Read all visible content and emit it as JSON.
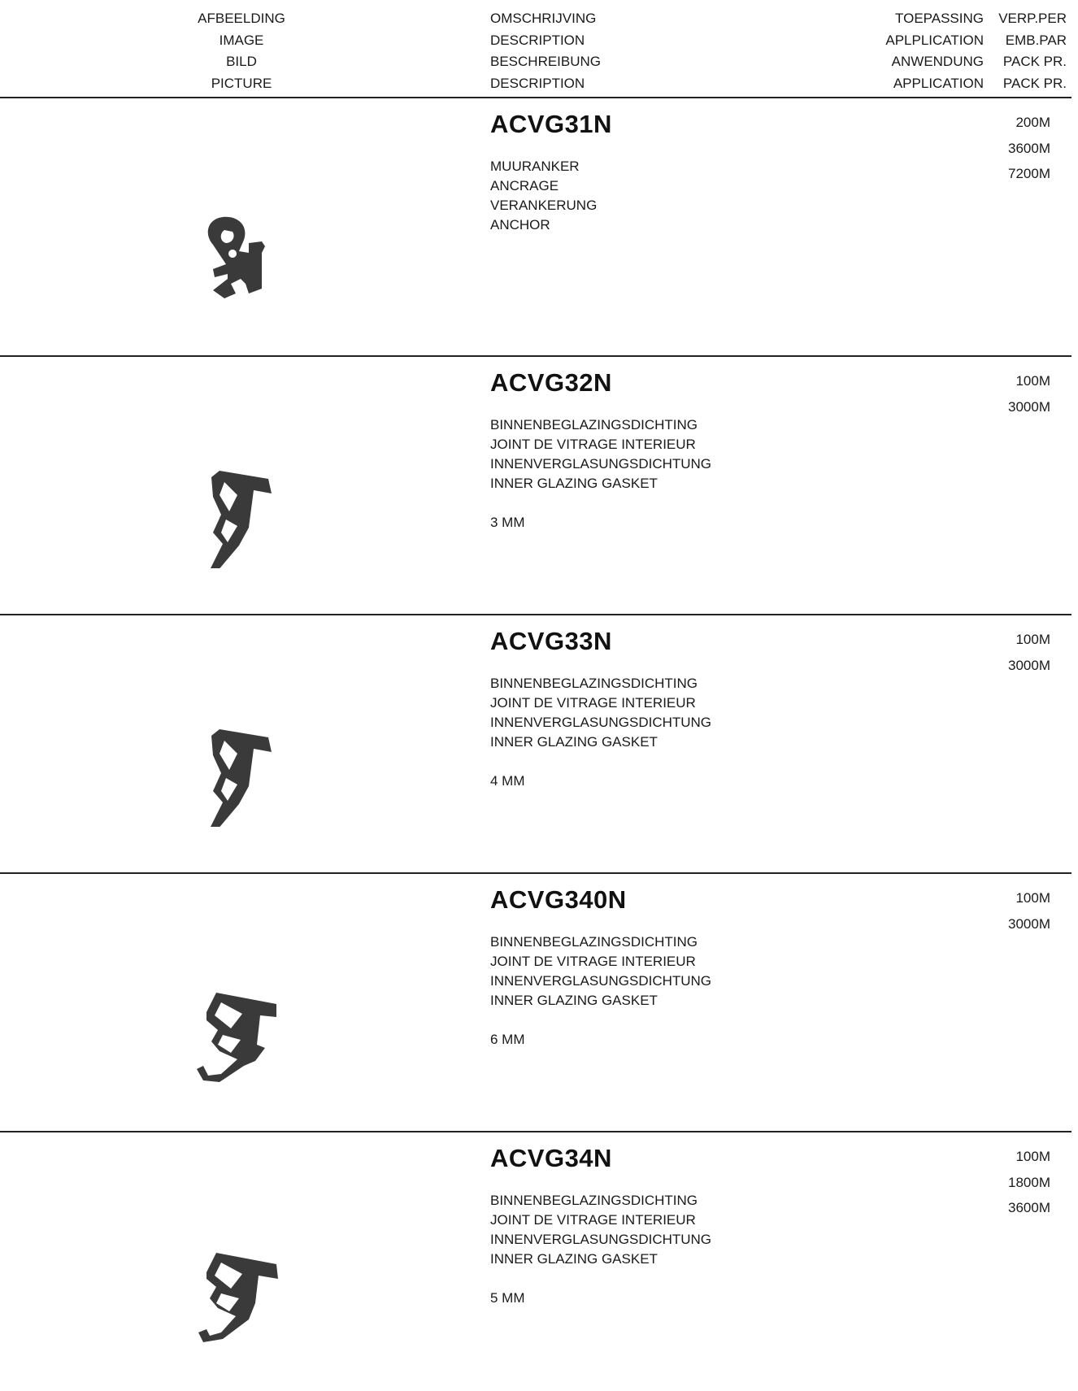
{
  "header": {
    "image": [
      "AFBEELDING",
      "IMAGE",
      "BILD",
      "PICTURE"
    ],
    "description": [
      "OMSCHRIJVING",
      "DESCRIPTION",
      "BESCHREIBUNG",
      "DESCRIPTION"
    ],
    "application": [
      "TOEPASSING",
      "APLPLICATION",
      "ANWENDUNG",
      "APPLICATION"
    ],
    "packaging": [
      "VERP.PER",
      "EMB.PAR",
      "PACK PR.",
      "PACK PR."
    ]
  },
  "products": [
    {
      "code": "ACVG31N",
      "description": [
        "MUURANKER",
        "ANCRAGE",
        "VERANKERUNG",
        "ANCHOR"
      ],
      "size": "",
      "packs": [
        "200M",
        "3600M",
        "7200M"
      ],
      "icon": "anchor-profile-icon"
    },
    {
      "code": "ACVG32N",
      "description": [
        "BINNENBEGLAZINGSDICHTING",
        "JOINT DE VITRAGE INTERIEUR",
        "INNENVERGLASUNGSDICHTUNG",
        "INNER GLAZING GASKET"
      ],
      "size": "3 MM",
      "packs": [
        "100M",
        "3000M"
      ],
      "icon": "glazing-gasket-profile-icon"
    },
    {
      "code": "ACVG33N",
      "description": [
        "BINNENBEGLAZINGSDICHTING",
        "JOINT DE VITRAGE INTERIEUR",
        "INNENVERGLASUNGSDICHTUNG",
        "INNER GLAZING GASKET"
      ],
      "size": "4 MM",
      "packs": [
        "100M",
        "3000M"
      ],
      "icon": "glazing-gasket-profile-icon"
    },
    {
      "code": "ACVG340N",
      "description": [
        "BINNENBEGLAZINGSDICHTING",
        "JOINT DE VITRAGE INTERIEUR",
        "INNENVERGLASUNGSDICHTUNG",
        "INNER GLAZING GASKET"
      ],
      "size": "6 MM",
      "packs": [
        "100M",
        "3000M"
      ],
      "icon": "glazing-gasket-profile-icon"
    },
    {
      "code": "ACVG34N",
      "description": [
        "BINNENBEGLAZINGSDICHTING",
        "JOINT DE VITRAGE INTERIEUR",
        "INNENVERGLASUNGSDICHTUNG",
        "INNER GLAZING GASKET"
      ],
      "size": "5 MM",
      "packs": [
        "100M",
        "1800M",
        "3600M"
      ],
      "icon": "glazing-gasket-profile-icon"
    }
  ]
}
